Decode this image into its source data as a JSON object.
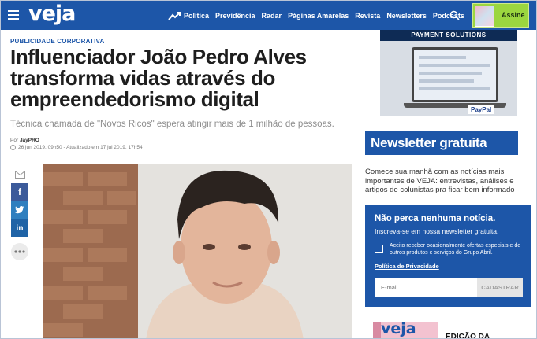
{
  "header": {
    "logo": "veja",
    "nav": [
      "Política",
      "Previdência",
      "Radar",
      "Páginas Amarelas",
      "Revista",
      "Newsletters",
      "Podcasts"
    ],
    "subscribe_label": "Assine",
    "brand_color": "#1d56a8"
  },
  "article": {
    "kicker": "PUBLICIDADE CORPORATIVA",
    "title": "Influenciador João Pedro Alves transforma vidas através do empreendedorismo digital",
    "subtitle": "Técnica chamada de \"Novos Ricos\" espera atingir mais de 1 milhão de pessoas.",
    "byline_prefix": "Por",
    "author": "JayPRO",
    "dates": "26 jun 2019, 09h50 - Atualizado em 17 jul 2019, 17h54"
  },
  "share": {
    "icons": [
      "mail-icon",
      "facebook-icon",
      "twitter-icon",
      "linkedin-icon",
      "more-icon"
    ]
  },
  "ad": {
    "title": "PAYMENT SOLUTIONS",
    "brand": "PayPal"
  },
  "newsletter": {
    "title": "Newsletter gratuita",
    "description": "Comece sua manhã com as notícias mais importantes de VEJA: entrevistas, análises e artigos de colunistas pra ficar bem informado",
    "box_title": "Não perca nenhuma notícia.",
    "box_subtitle": "Inscreva-se em nossa newsletter gratuita.",
    "consent": "Aceito receber ocasionalmente ofertas especiais e de outros produtos e serviços do Grupo Abril.",
    "privacy": "Política de Privacidade",
    "email_placeholder": "E-mail",
    "submit": "CADASTRAR"
  },
  "edition": {
    "thumb_logo": "veja",
    "title": "EDIÇÃO DA"
  }
}
